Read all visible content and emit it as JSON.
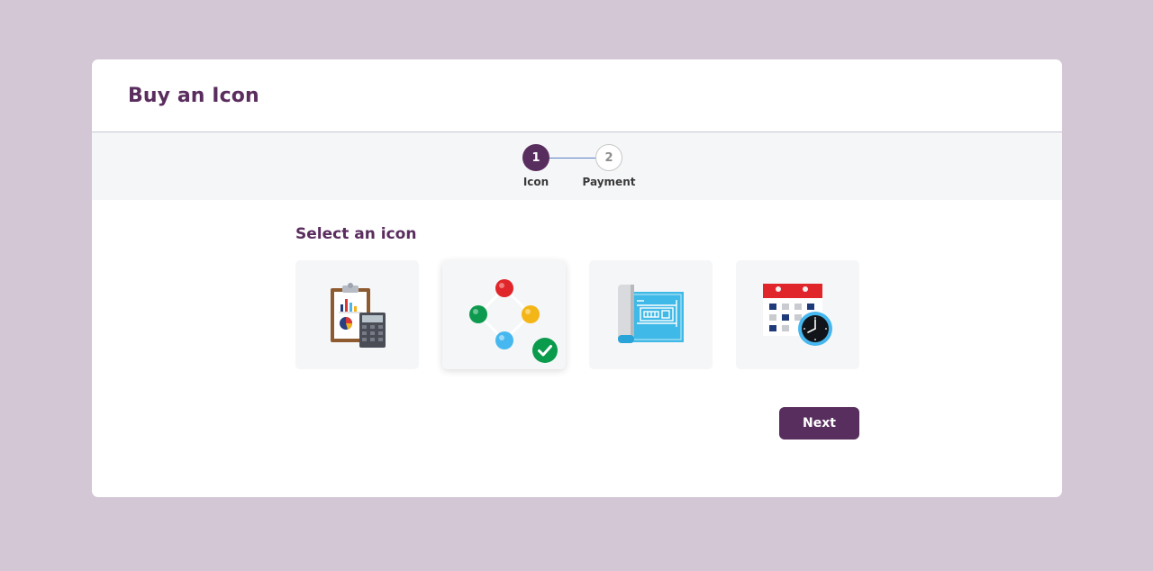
{
  "header": {
    "title": "Buy an Icon"
  },
  "stepper": {
    "steps": [
      {
        "number": "1",
        "label": "Icon",
        "state": "active"
      },
      {
        "number": "2",
        "label": "Payment",
        "state": "inactive"
      }
    ]
  },
  "main": {
    "section_title": "Select an icon",
    "icons": [
      {
        "icon": "clipboard-calculator-icon",
        "selected": false
      },
      {
        "icon": "network-nodes-icon",
        "selected": true
      },
      {
        "icon": "blueprint-icon",
        "selected": false
      },
      {
        "icon": "calendar-clock-icon",
        "selected": false
      }
    ],
    "next_label": "Next"
  },
  "colors": {
    "background": "#d3c6d5",
    "brand": "#582e5e",
    "title": "#5a2d5e",
    "band": "#f5f6f8",
    "success": "#0a9b4c"
  }
}
